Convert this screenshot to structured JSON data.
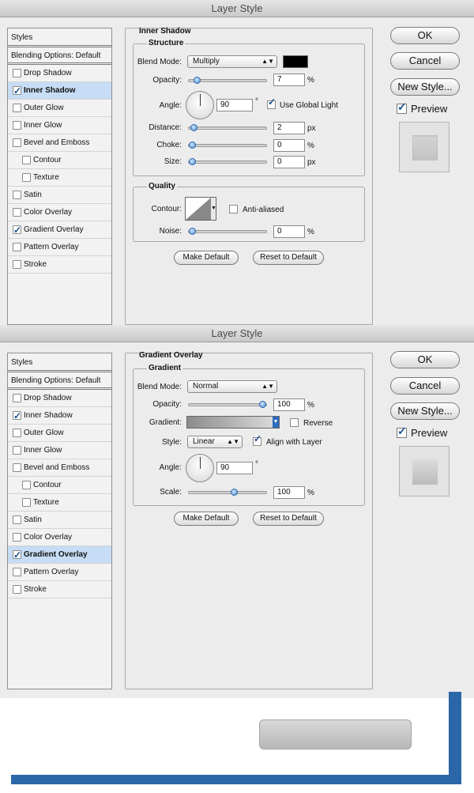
{
  "dialog1": {
    "title": "Layer Style",
    "list": {
      "header": "Styles",
      "blending": "Blending Options: Default",
      "items": [
        {
          "label": "Drop Shadow",
          "checked": false,
          "sub": false,
          "selected": false
        },
        {
          "label": "Inner Shadow",
          "checked": true,
          "sub": false,
          "selected": true
        },
        {
          "label": "Outer Glow",
          "checked": false,
          "sub": false,
          "selected": false
        },
        {
          "label": "Inner Glow",
          "checked": false,
          "sub": false,
          "selected": false
        },
        {
          "label": "Bevel and Emboss",
          "checked": false,
          "sub": false,
          "selected": false
        },
        {
          "label": "Contour",
          "checked": false,
          "sub": true,
          "selected": false
        },
        {
          "label": "Texture",
          "checked": false,
          "sub": true,
          "selected": false
        },
        {
          "label": "Satin",
          "checked": false,
          "sub": false,
          "selected": false
        },
        {
          "label": "Color Overlay",
          "checked": false,
          "sub": false,
          "selected": false
        },
        {
          "label": "Gradient Overlay",
          "checked": true,
          "sub": false,
          "selected": false
        },
        {
          "label": "Pattern Overlay",
          "checked": false,
          "sub": false,
          "selected": false
        },
        {
          "label": "Stroke",
          "checked": false,
          "sub": false,
          "selected": false
        }
      ]
    },
    "section_title": "Inner Shadow",
    "structure": {
      "label": "Structure",
      "blend_mode_label": "Blend Mode:",
      "blend_mode": "Multiply",
      "swatch_color": "#000000",
      "opacity_label": "Opacity:",
      "opacity": "7",
      "opacity_level": 0.07,
      "opacity_unit": "%",
      "angle_label": "Angle:",
      "angle": "90",
      "degree": "°",
      "global_light_label": "Use Global Light",
      "global_light": true,
      "distance_label": "Distance:",
      "distance": "2",
      "distance_level": 0.02,
      "distance_unit": "px",
      "choke_label": "Choke:",
      "choke": "0",
      "choke_level": 0.0,
      "choke_unit": "%",
      "size_label": "Size:",
      "size": "0",
      "size_level": 0.0,
      "size_unit": "px"
    },
    "quality": {
      "label": "Quality",
      "contour_label": "Contour:",
      "anti_aliased_label": "Anti-aliased",
      "anti_aliased": false,
      "noise_label": "Noise:",
      "noise": "0",
      "noise_level": 0.0,
      "noise_unit": "%"
    },
    "make_default": "Make Default",
    "reset_default": "Reset to Default",
    "ok": "OK",
    "cancel": "Cancel",
    "new_style": "New Style...",
    "preview_label": "Preview",
    "preview": true
  },
  "dialog2": {
    "title": "Layer Style",
    "list": {
      "header": "Styles",
      "blending": "Blending Options: Default",
      "items": [
        {
          "label": "Drop Shadow",
          "checked": false,
          "sub": false,
          "selected": false
        },
        {
          "label": "Inner Shadow",
          "checked": true,
          "sub": false,
          "selected": false
        },
        {
          "label": "Outer Glow",
          "checked": false,
          "sub": false,
          "selected": false
        },
        {
          "label": "Inner Glow",
          "checked": false,
          "sub": false,
          "selected": false
        },
        {
          "label": "Bevel and Emboss",
          "checked": false,
          "sub": false,
          "selected": false
        },
        {
          "label": "Contour",
          "checked": false,
          "sub": true,
          "selected": false
        },
        {
          "label": "Texture",
          "checked": false,
          "sub": true,
          "selected": false
        },
        {
          "label": "Satin",
          "checked": false,
          "sub": false,
          "selected": false
        },
        {
          "label": "Color Overlay",
          "checked": false,
          "sub": false,
          "selected": false
        },
        {
          "label": "Gradient Overlay",
          "checked": true,
          "sub": false,
          "selected": true
        },
        {
          "label": "Pattern Overlay",
          "checked": false,
          "sub": false,
          "selected": false
        },
        {
          "label": "Stroke",
          "checked": false,
          "sub": false,
          "selected": false
        }
      ]
    },
    "section_title": "Gradient Overlay",
    "gradient": {
      "label": "Gradient",
      "blend_mode_label": "Blend Mode:",
      "blend_mode": "Normal",
      "opacity_label": "Opacity:",
      "opacity": "100",
      "opacity_level": 1.0,
      "opacity_unit": "%",
      "gradient_label": "Gradient:",
      "reverse_label": "Reverse",
      "reverse": false,
      "style_label": "Style:",
      "style": "Linear",
      "align_label": "Align with Layer",
      "align": true,
      "angle_label": "Angle:",
      "angle": "90",
      "degree": "°",
      "scale_label": "Scale:",
      "scale": "100",
      "scale_level": 0.6,
      "scale_unit": "%"
    },
    "make_default": "Make Default",
    "reset_default": "Reset to Default",
    "ok": "OK",
    "cancel": "Cancel",
    "new_style": "New Style...",
    "preview_label": "Preview",
    "preview": true
  },
  "colors": {
    "accent_blue": "#2a66a8",
    "selection": "#c7dcf5"
  }
}
